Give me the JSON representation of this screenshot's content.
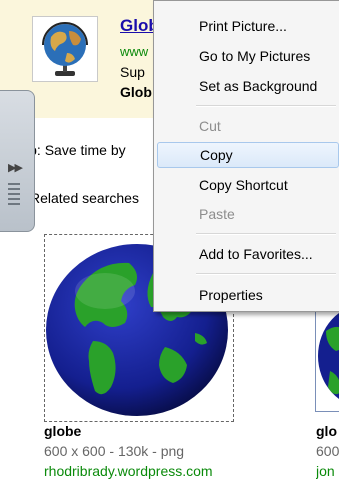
{
  "ad": {
    "title": "Globe",
    "url": "www",
    "line1": "Sup",
    "line2": "Glob"
  },
  "tip": "Tip: Save time by",
  "related": "Related searches",
  "results": [
    {
      "title": "globe",
      "meta": "600 x 600 - 130k - png",
      "site": "rhodribrady.wordpress.com"
    },
    {
      "title": "glo",
      "meta": "600",
      "site": "jon"
    }
  ],
  "context_menu": {
    "items": [
      {
        "label": "Print Picture...",
        "disabled": false
      },
      {
        "label": "Go to My Pictures",
        "disabled": false
      },
      {
        "label": "Set as Background",
        "disabled": false
      },
      {
        "label": "Cut",
        "disabled": true
      },
      {
        "label": "Copy",
        "disabled": false,
        "hover": true
      },
      {
        "label": "Copy Shortcut",
        "disabled": false
      },
      {
        "label": "Paste",
        "disabled": true
      },
      {
        "label": "Add to Favorites...",
        "disabled": false
      },
      {
        "label": "Properties",
        "disabled": false
      }
    ]
  },
  "colors": {
    "link": "#1a0dab",
    "url_green": "#0a8a0a",
    "ad_background": "#fbf6dc",
    "menu_hover": "#dbe9f9"
  }
}
